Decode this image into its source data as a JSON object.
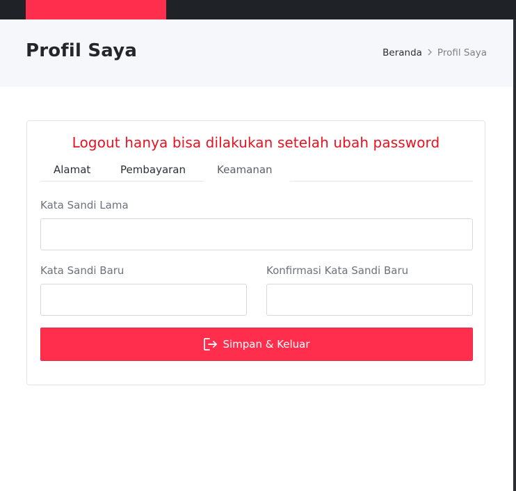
{
  "colors": {
    "accent": "#ff2e4d",
    "warning_text": "#e8111f",
    "topbar": "#1f2328",
    "header_bg": "#f6f7fb"
  },
  "header": {
    "title": "Profil Saya",
    "breadcrumb": {
      "home": "Beranda",
      "separator_icon": "chevron-right-icon",
      "current": "Profil Saya"
    }
  },
  "card": {
    "warning": "Logout hanya bisa dilakukan setelah ubah password",
    "tabs": [
      {
        "label": "Alamat",
        "active": false
      },
      {
        "label": "Pembayaran",
        "active": false
      },
      {
        "label": "Keamanan",
        "active": true
      }
    ],
    "form": {
      "old_password": {
        "label": "Kata Sandi Lama",
        "value": "",
        "placeholder": ""
      },
      "new_password": {
        "label": "Kata Sandi Baru",
        "value": "",
        "placeholder": ""
      },
      "confirm_password": {
        "label": "Konfirmasi Kata Sandi Baru",
        "value": "",
        "placeholder": ""
      }
    },
    "submit": {
      "label": "Simpan & Keluar",
      "icon": "logout-icon"
    }
  }
}
